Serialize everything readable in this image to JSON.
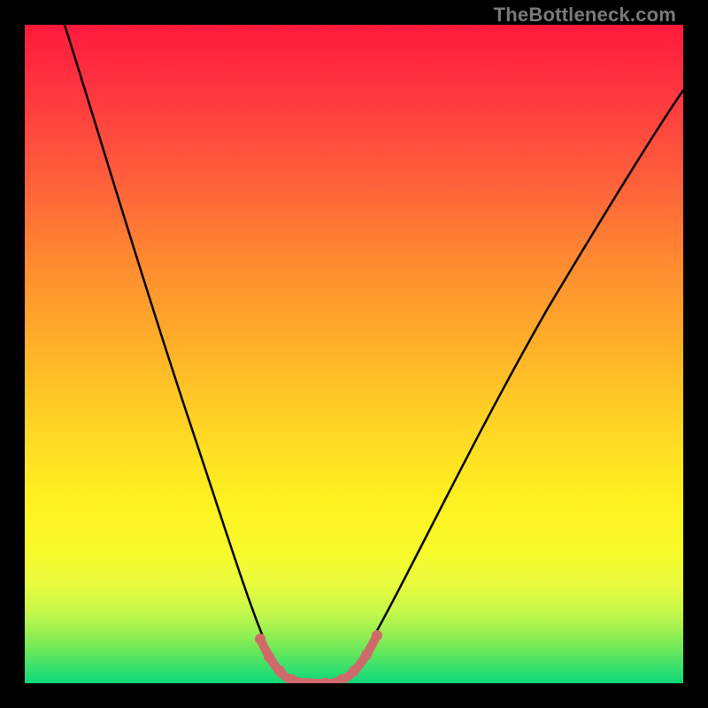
{
  "watermark": "TheBottleneck.com",
  "chart_data": {
    "type": "line",
    "title": "",
    "xlabel": "",
    "ylabel": "",
    "xlim": [
      0,
      100
    ],
    "ylim": [
      0,
      100
    ],
    "background_gradient": {
      "top_color_meaning": "bad",
      "bottom_color_meaning": "good",
      "stops": [
        "#ff1a3b",
        "#ff8a30",
        "#fff020",
        "#0fd878"
      ]
    },
    "series": [
      {
        "name": "bottleneck-curve",
        "color": "#000000",
        "x": [
          0,
          6,
          12,
          18,
          24,
          30,
          36,
          38,
          40,
          42,
          44,
          46,
          48,
          50,
          56,
          62,
          70,
          80,
          90,
          100
        ],
        "y": [
          100,
          88,
          75,
          62,
          49,
          35,
          12,
          5,
          1,
          0,
          0,
          0.5,
          2,
          5,
          15,
          25,
          38,
          52,
          62,
          70
        ]
      },
      {
        "name": "bottleneck-floor-highlight",
        "color": "#d15a5a",
        "x": [
          36,
          38,
          40,
          42,
          44,
          46,
          48,
          50
        ],
        "y": [
          3.5,
          1.7,
          0.4,
          0,
          0,
          0.3,
          1.2,
          3.2
        ]
      }
    ],
    "annotations": []
  }
}
